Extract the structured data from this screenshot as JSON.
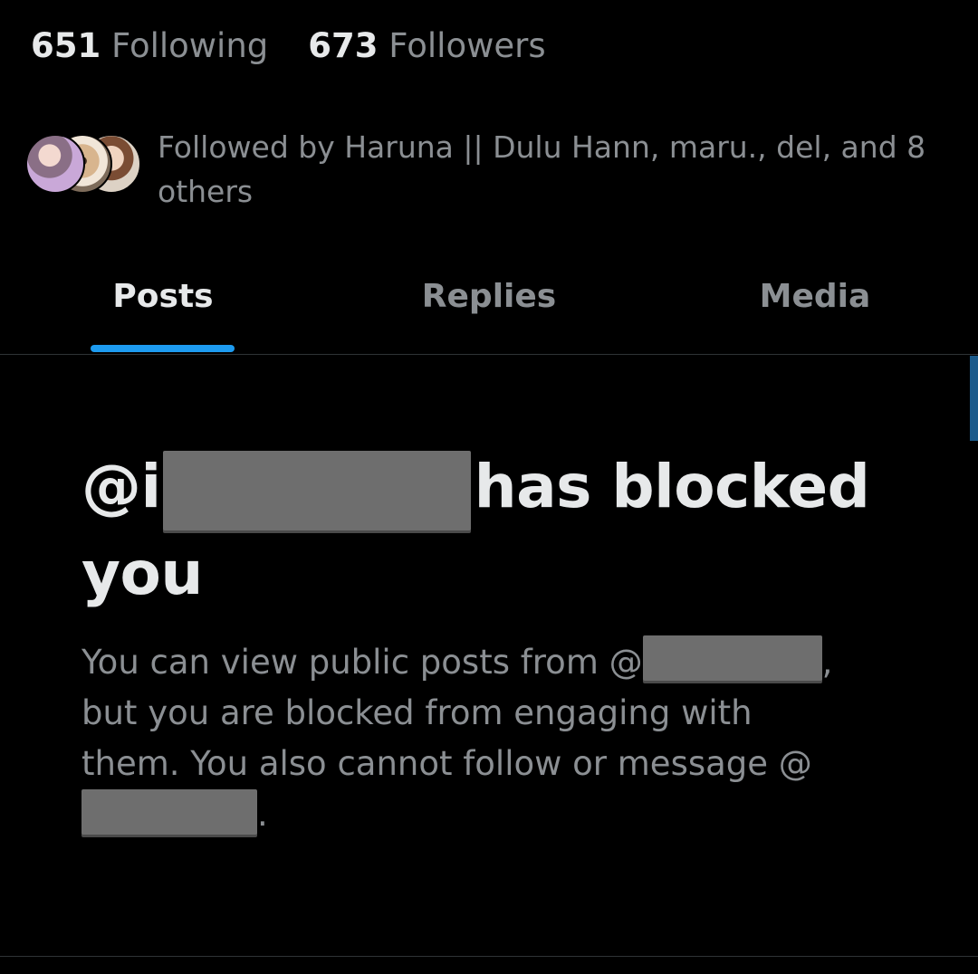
{
  "profile_stats": {
    "following_count": "651",
    "following_label": "Following",
    "followers_count": "673",
    "followers_label": "Followers"
  },
  "followed_by": {
    "text": "Followed by Haruna || Dulu Hann, maru., del, and 8 others"
  },
  "tabs": [
    {
      "label": "Posts",
      "selected": true
    },
    {
      "label": "Replies",
      "selected": false
    },
    {
      "label": "Media",
      "selected": false
    }
  ],
  "blocked_notice": {
    "title_prefix": "@i",
    "title_suffix": "has blocked you",
    "desc_part1": "You can view public posts from @",
    "desc_part2": ", but you are blocked from engaging with them. You also cannot follow or message @",
    "desc_part3": "."
  },
  "colors": {
    "background": "#000000",
    "primary_text": "#e7e9ea",
    "secondary_text": "#8b8f93",
    "accent": "#1d9bf0",
    "divider": "#2f3336"
  }
}
